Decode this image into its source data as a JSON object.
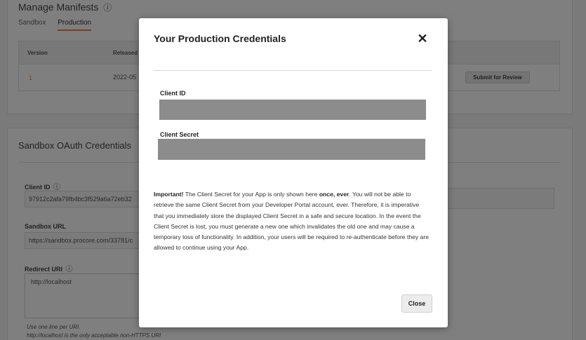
{
  "background": {
    "manifests": {
      "title": "Manage Manifests",
      "info_glyph": "ⓘ",
      "tabs": [
        {
          "label": "Sandbox",
          "active": false
        },
        {
          "label": "Production",
          "active": true
        }
      ],
      "table": {
        "headers": [
          "Version",
          "Released"
        ],
        "rows": [
          {
            "version": "1",
            "released": "2022-05",
            "action": "Submit for Review"
          }
        ]
      }
    },
    "oauth": {
      "title": "Sandbox OAuth Credentials",
      "client_id_label": "Client ID",
      "client_id_value": "97912c2afa79fb4bc3f529a6a72eb32",
      "sandbox_url_label": "Sandbox URL",
      "sandbox_url_value": "https://sandbox.procore.com/33781/c",
      "redirect_uri_label": "Redirect URI",
      "redirect_uri_value": "http://localhost",
      "hint_1": "Use one line per URI.",
      "hint_2": "http://localhost is the only acceptable non-HTTPS URI",
      "info_glyph": "ⓘ"
    }
  },
  "modal": {
    "title": "Your Production Credentials",
    "close_glyph": "✕",
    "client_id_label": "Client ID",
    "client_secret_label": "Client Secret",
    "redacted_color": "#8c8c8c",
    "notice_strong": "Important!",
    "notice_part1": " The Client Secret for your App is only shown here ",
    "notice_emph": "once, ever",
    "notice_part2": ". You will not be able to retrieve the same Client Secret from your Developer Portal account, ever. Therefore, it is imperative that you immediately store the displayed Client Secret in a safe and secure location. In the event the Client Secret is lost, you must generate a new one which invalidates the old one and may cause a temporary loss of functionality. In addition, your users will be required to re-authenticate before they are allowed to continue using your App.",
    "close_button": "Close"
  },
  "colors": {
    "accent": "#f47e42",
    "overlay": "rgba(0,0,0,0.5)"
  }
}
